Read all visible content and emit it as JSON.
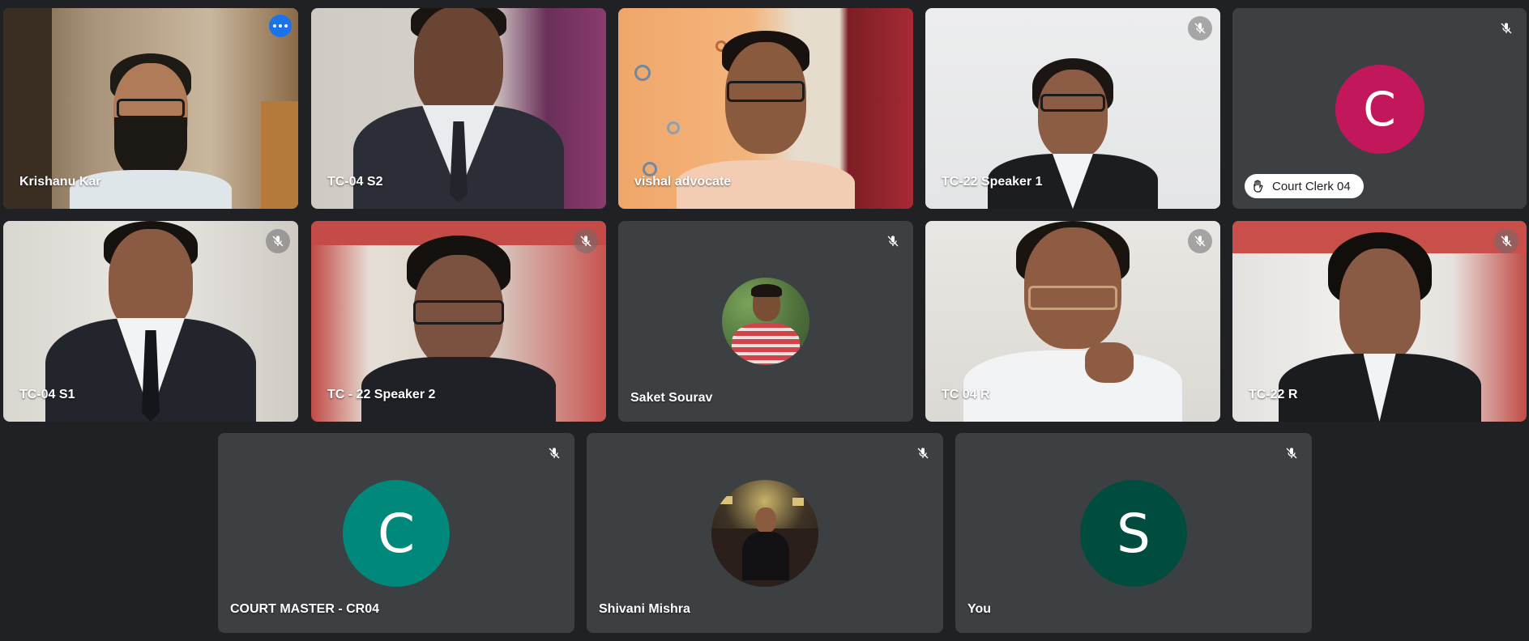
{
  "meeting": {
    "participants": [
      {
        "id": "p1",
        "name": "Krishanu Kar",
        "speaking": true,
        "muted": false,
        "options_icon": "more-horiz-icon"
      },
      {
        "id": "p2",
        "name": "TC-04 S2",
        "muted": false
      },
      {
        "id": "p3",
        "name": "vishal advocate",
        "muted": false
      },
      {
        "id": "p4",
        "name": "TC-22 Speaker 1",
        "muted": true
      },
      {
        "id": "p5",
        "name": "Court Clerk 04",
        "avatar_letter": "C",
        "avatar_color": "#c2185b",
        "hand_raised": true,
        "muted": true
      },
      {
        "id": "p6",
        "name": "TC-04 S1",
        "muted": true
      },
      {
        "id": "p7",
        "name": "TC - 22 Speaker 2",
        "muted": true
      },
      {
        "id": "p8",
        "name": "Saket Sourav",
        "muted": true,
        "avatar": "profile-photo"
      },
      {
        "id": "p9",
        "name": "TC 04 R",
        "muted": true
      },
      {
        "id": "p10",
        "name": "TC-22 R",
        "muted": true
      },
      {
        "id": "p11",
        "name": "COURT MASTER - CR04",
        "avatar_letter": "C",
        "avatar_color": "#00897b",
        "muted": true
      },
      {
        "id": "p12",
        "name": "Shivani Mishra",
        "muted": true,
        "avatar": "profile-photo"
      },
      {
        "id": "p13",
        "name": "You",
        "avatar_letter": "S",
        "avatar_color": "#004d40",
        "muted": true
      }
    ],
    "colors": {
      "background": "#202124",
      "tile": "#3c4043",
      "active_speaker_border": "#8ab4f8",
      "options_button": "#1a73e8"
    }
  }
}
